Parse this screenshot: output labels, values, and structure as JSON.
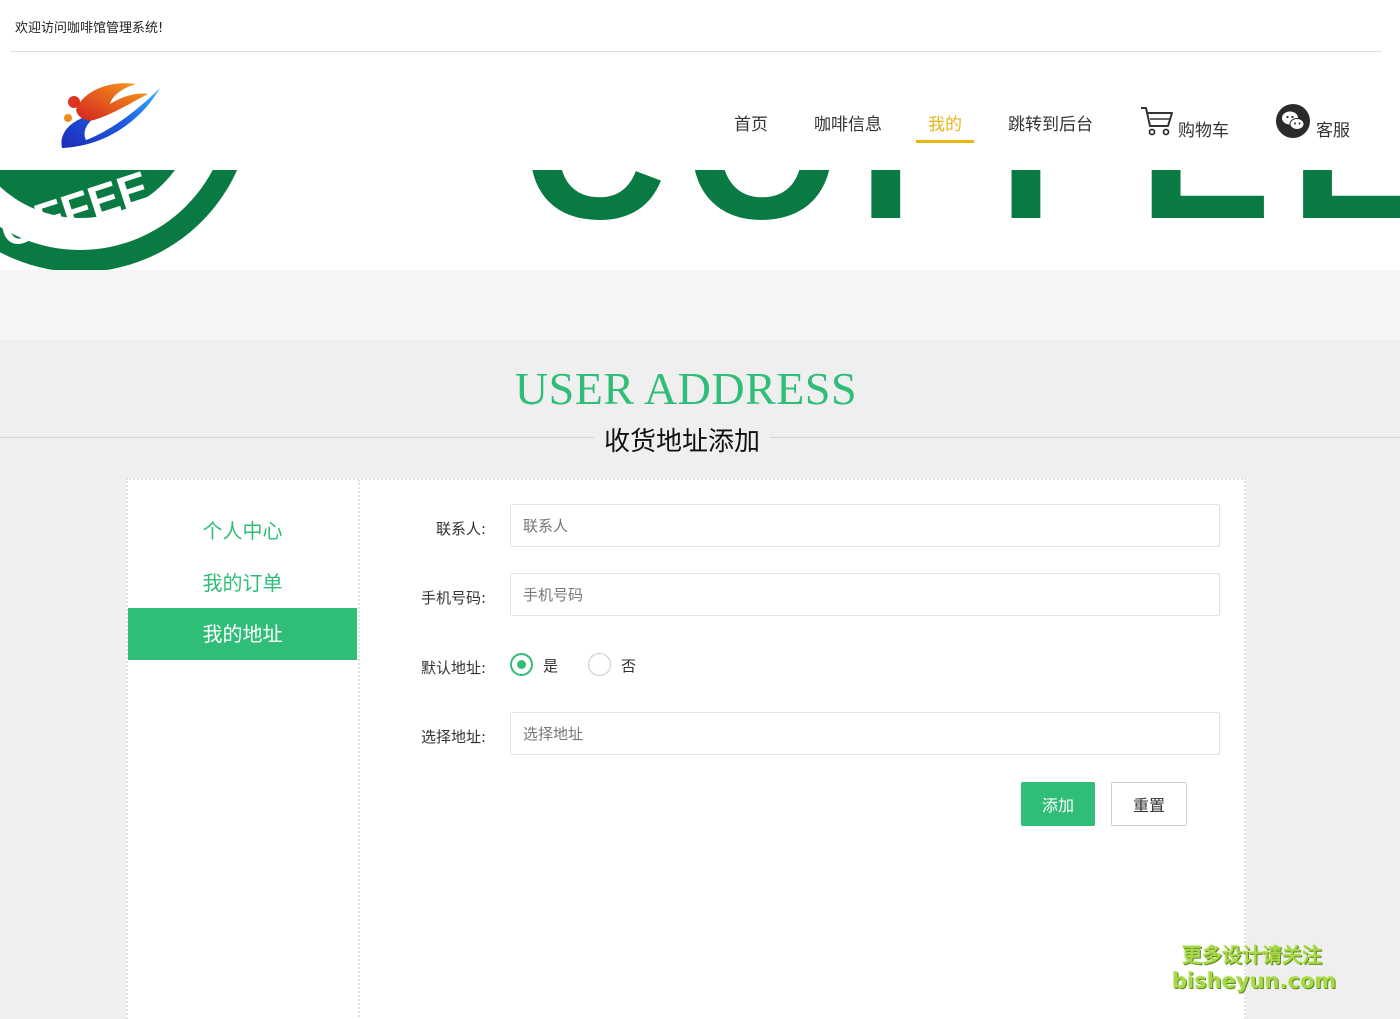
{
  "topbar": {
    "welcome": "欢迎访问咖啡馆管理系统!"
  },
  "nav": {
    "items": [
      {
        "label": "首页",
        "active": false
      },
      {
        "label": "咖啡信息",
        "active": false
      },
      {
        "label": "我的",
        "active": true
      },
      {
        "label": "跳转到后台",
        "active": false
      }
    ],
    "cart_label": "购物车",
    "service_label": "客服",
    "active_color": "#e8b416"
  },
  "banner": {
    "text": "COFFEE",
    "badge_text": "OFFEE"
  },
  "section": {
    "title_en": "USER ADDRESS",
    "title_cn": "收货地址添加"
  },
  "sidebar": {
    "items": [
      {
        "label": "个人中心",
        "active": false
      },
      {
        "label": "我的订单",
        "active": false
      },
      {
        "label": "我的地址",
        "active": true
      }
    ]
  },
  "form": {
    "contact_label": "联系人:",
    "contact_placeholder": "联系人",
    "phone_label": "手机号码:",
    "phone_placeholder": "手机号码",
    "default_label": "默认地址:",
    "default_yes": "是",
    "default_no": "否",
    "default_selected": "是",
    "address_label": "选择地址:",
    "address_placeholder": "选择地址",
    "add_button": "添加",
    "reset_button": "重置"
  },
  "watermark": {
    "line1": "更多设计请关注",
    "line2": "bisheyun.com"
  },
  "colors": {
    "accent": "#2fbd78",
    "nav_active": "#e8b416",
    "coffee_green": "#0a7a43"
  }
}
